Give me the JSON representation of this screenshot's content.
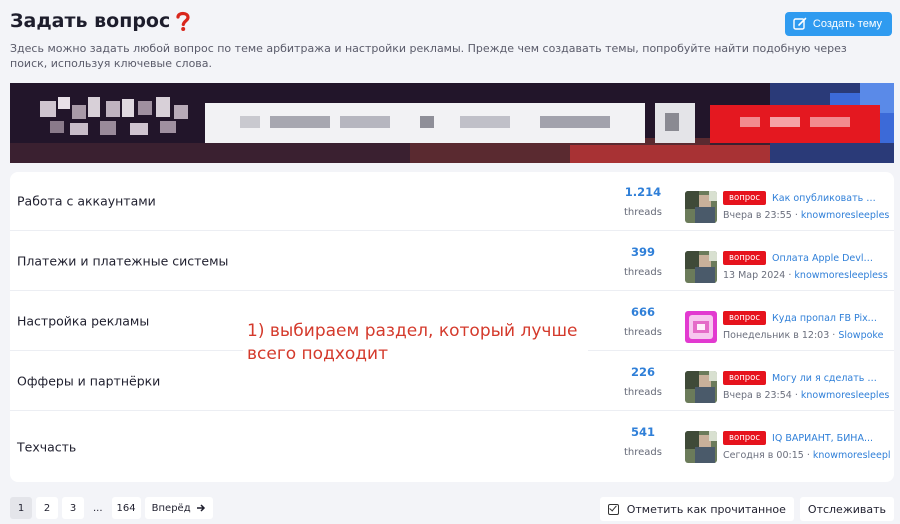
{
  "page": {
    "title": "Задать вопрос",
    "description": "Здесь можно задать любой вопрос по теме арбитража и настройки рекламы. Прежде чем создавать темы, попробуйте найти подобную через поиск, используя ключевые слова.",
    "create_button": "Создать тему"
  },
  "sections": [
    {
      "title": "Работа с аккаунтами",
      "threads": "1.214",
      "threads_label": "threads",
      "badge": "вопрос",
      "latest_title": "Как опубликовать в...",
      "latest_date": "Вчера в 23:55",
      "latest_user": "knowmoresleeples"
    },
    {
      "title": "Платежи и платежные системы",
      "threads": "399",
      "threads_label": "threads",
      "badge": "вопрос",
      "latest_title": "Оплата Apple Devlo...",
      "latest_date": "13 Мар 2024",
      "latest_user": "knowmoresleepless"
    },
    {
      "title": "Настройка рекламы",
      "threads": "666",
      "threads_label": "threads",
      "badge": "вопрос",
      "latest_title": "Куда пропал FB Pixe...",
      "latest_date": "Понедельник в 12:03",
      "latest_user": "Slowpoke"
    },
    {
      "title": "Офферы и партнёрки",
      "threads": "226",
      "threads_label": "threads",
      "badge": "вопрос",
      "latest_title": "Могу ли я сделать д...",
      "latest_date": "Вчера в 23:54",
      "latest_user": "knowmoresleeples"
    },
    {
      "title": "Техчасть",
      "threads": "541",
      "threads_label": "threads",
      "badge": "вопрос",
      "latest_title": "IQ ВАРИАНТ, БИНА...",
      "latest_date": "Сегодня в 00:15",
      "latest_user": "knowmoresleepl"
    }
  ],
  "annotation": "1) выбираем раздел, который лучше всего подходит",
  "pagination": {
    "pages": [
      "1",
      "2",
      "3",
      "...",
      "164"
    ],
    "next_label": "Вперёд"
  },
  "actions": {
    "mark_read": "Отметить как прочитанное",
    "watch": "Отслеживать"
  },
  "colors": {
    "accent": "#2f9bf0",
    "link": "#2f7fd8",
    "badge": "#e6131d",
    "annotation": "#d43a2c"
  }
}
